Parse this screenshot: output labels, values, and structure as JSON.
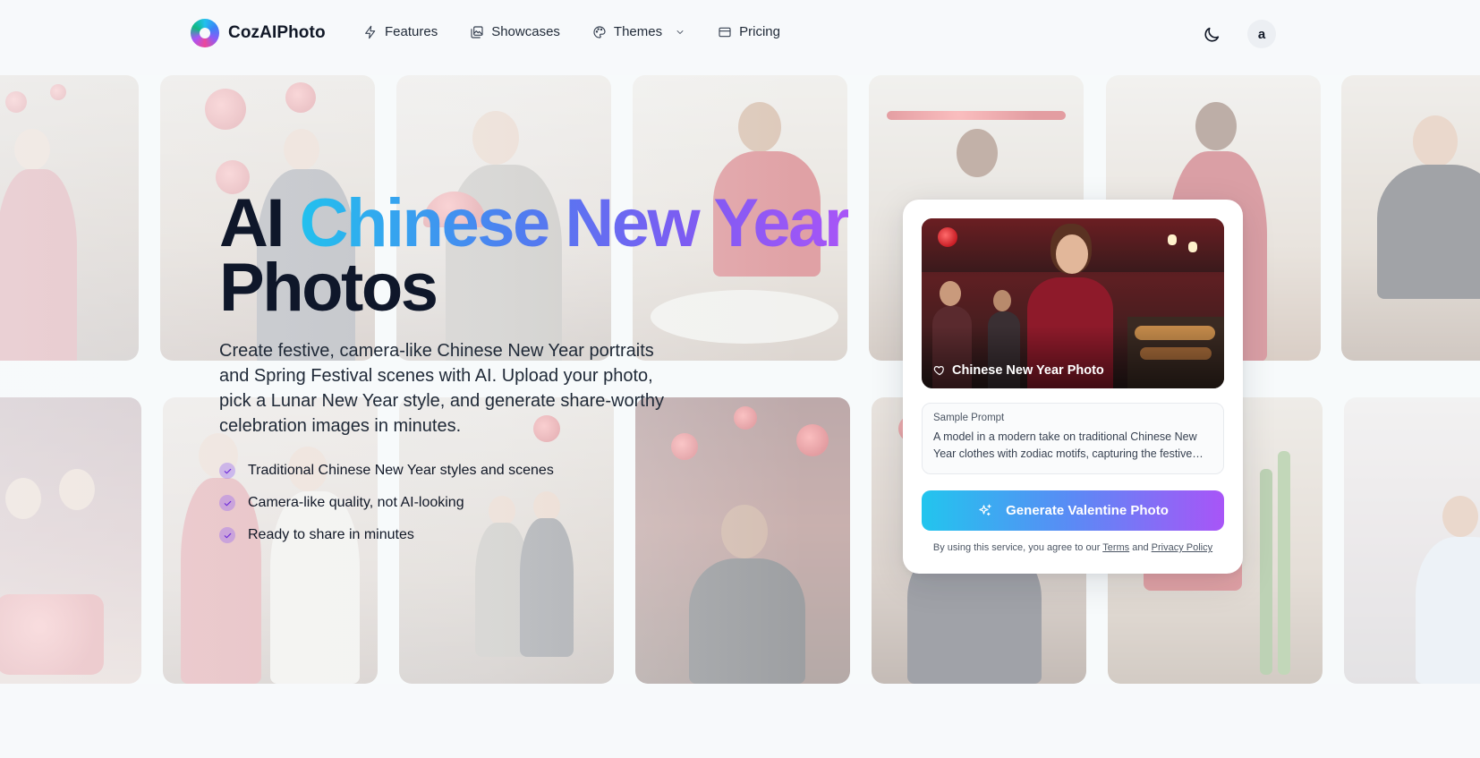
{
  "header": {
    "brand": "CozAIPhoto",
    "nav": [
      {
        "label": "Features",
        "icon": "bolt-icon"
      },
      {
        "label": "Showcases",
        "icon": "gallery-icon"
      },
      {
        "label": "Themes",
        "icon": "palette-icon"
      },
      {
        "label": "Pricing",
        "icon": "card-icon"
      }
    ],
    "avatar_initial": "a"
  },
  "hero": {
    "title_plain": "AI",
    "title_gradient": "Chinese New Year",
    "title_line2": "Photos",
    "description": "Create festive, camera-like Chinese New Year portraits and Spring Festival scenes with AI. Upload your photo, pick a Lunar New Year style, and generate share-worthy celebration images in minutes.",
    "features": [
      "Traditional Chinese New Year styles and scenes",
      "Camera-like quality, not AI-looking",
      "Ready to share in minutes"
    ]
  },
  "card": {
    "caption": "Chinese New Year Photo",
    "prompt_label": "Sample Prompt",
    "prompt_text": "A model in a modern take on traditional Chinese New Year clothes with zodiac motifs, capturing the festive spirit of the Spring Festival.",
    "button_label": "Generate Valentine Photo",
    "legal_prefix": "By using this service, you agree to our",
    "terms": "Terms",
    "and": "and",
    "privacy": "Privacy Policy"
  },
  "colors": {
    "gradient_start": "#22c1ee",
    "gradient_end": "#a855f7",
    "festive_red": "#c81d25"
  }
}
